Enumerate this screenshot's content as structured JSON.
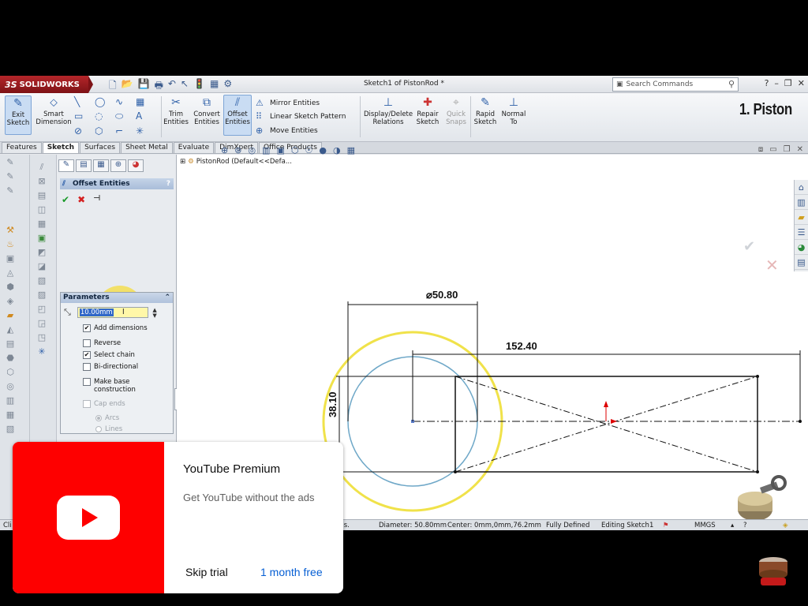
{
  "app": {
    "brand": "SOLIDWORKS",
    "brand_prefix": "3S",
    "document_title": "Sketch1 of PistonRod *",
    "search_placeholder": "Search Commands",
    "overlay_caption": "1. Piston"
  },
  "toolbar": {
    "exit_sketch": "Exit Sketch",
    "smart_dimension": "Smart Dimension",
    "trim_entities": "Trim Entities",
    "convert_entities": "Convert Entities",
    "offset_entities": "Offset Entities",
    "mirror_entities": "Mirror Entities",
    "linear_sketch_pattern": "Linear Sketch Pattern",
    "move_entities": "Move Entities",
    "display_delete_relations": "Display/Delete Relations",
    "repair_sketch": "Repair Sketch",
    "quick_snaps": "Quick Snaps",
    "rapid_sketch": "Rapid Sketch",
    "normal_to": "Normal To"
  },
  "tabs": [
    "Features",
    "Sketch",
    "Surfaces",
    "Sheet Metal",
    "Evaluate",
    "DimXpert",
    "Office Products"
  ],
  "active_tab": "Sketch",
  "property_manager": {
    "title": "Offset Entities",
    "help": "?",
    "group_title": "Parameters",
    "distance_value": "10.00mm",
    "options": [
      {
        "label": "Add dimensions",
        "checked": true,
        "enabled": true
      },
      {
        "label": "Reverse",
        "checked": false,
        "enabled": true
      },
      {
        "label": "Select chain",
        "checked": true,
        "enabled": true
      },
      {
        "label": "Bi-directional",
        "checked": false,
        "enabled": true
      },
      {
        "label": "Make base construction",
        "checked": false,
        "enabled": true
      },
      {
        "label": "Cap ends",
        "checked": false,
        "enabled": false
      }
    ],
    "cap_types": [
      {
        "label": "Arcs",
        "selected": true
      },
      {
        "label": "Lines",
        "selected": false
      }
    ]
  },
  "feature_tree": {
    "root": "PistonRod  (Default<<Defa..."
  },
  "sketch": {
    "diameter_dim": "⌀50.80",
    "length_dim": "152.40",
    "height_dim": "38.10"
  },
  "status_bar": {
    "left_clip": "Cli",
    "ins_clip": "ins.",
    "diameter": "Diameter: 50.80mm",
    "center": "Center: 0mm,0mm,76.2mm",
    "definition": "Fully Defined",
    "mode": "Editing Sketch1",
    "units": "MMGS"
  },
  "ad": {
    "title": "YouTube Premium",
    "subtitle": "Get YouTube without the ads",
    "skip": "Skip trial",
    "cta": "1 month free"
  },
  "colors": {
    "brand_red": "#b5262a",
    "yt_red": "#fe0000",
    "cta_blue": "#065fd4",
    "sketch_blue": "#6fa8c8",
    "highlight_yellow": "#f0e24a"
  }
}
